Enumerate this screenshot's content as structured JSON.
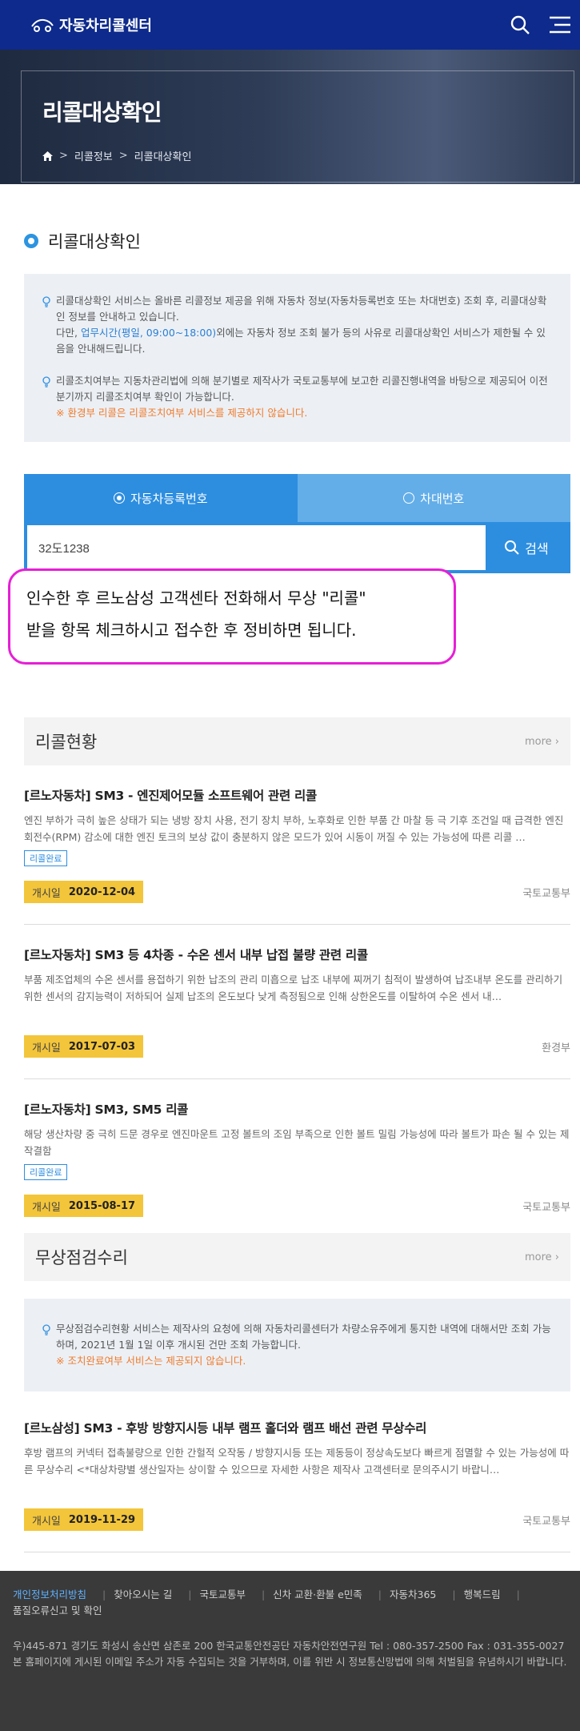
{
  "header": {
    "logo": "자동차리콜센터"
  },
  "hero": {
    "title": "리콜대상확인",
    "crumbs": [
      "리콜정보",
      "리콜대상확인"
    ]
  },
  "section": {
    "title": "리콜대상확인"
  },
  "info": {
    "p1_a": "리콜대상확인 서비스는 올바른 리콜정보 제공을 위해 자동차 정보(자동차등록번호 또는 차대번호) 조회 후, 리콜대상확인 정보를 안내하고 있습니다.",
    "p1_b_pre": "다만, ",
    "p1_b_link": "업무시간(평일, 09:00~18:00)",
    "p1_b_post": "외에는 자동차 정보 조회 불가 등의 사유로 리콜대상확인 서비스가 제한될 수 있음을 안내해드립니다.",
    "p2": "리콜조치여부는 지동차관리법에 의해 분기별로 제작사가 국토교통부에 보고한 리콜진행내역을 바탕으로 제공되어 이전 분기까지 리콜조치여부 확인이 가능합니다.",
    "p2_warn": "※ 환경부 리콜은 리콜조치여부 서비스를 제공하지 않습니다."
  },
  "tabs": [
    {
      "label": "자동차등록번호"
    },
    {
      "label": "차대번호"
    }
  ],
  "search": {
    "value": "32도1238",
    "button": "검색"
  },
  "note": {
    "line1": "인수한 후  르노삼성 고객센타 전화해서 무상 \"리콜\"",
    "line2": "받을 항목 체크하시고 접수한 후  정비하면 됩니다."
  },
  "recall": {
    "title": "리콜현황",
    "more": "more",
    "items": [
      {
        "title": "[르노자동차] SM3 - 엔진제어모듈 소프트웨어 관련 리콜",
        "desc": "엔진 부하가 극히 높은 상태가 되는 냉방 장치 사용, 전기 장치 부하, 노후화로 인한 부품 간 마찰 등 극 기후 조건일 때 급격한 엔진회전수(RPM) 감소에 대한 엔진 토크의 보상 값이 충분하지 않은 모드가 있어 시동이 꺼질 수 있는 가능성에 따른 리콜 …",
        "badge": "리콜완료",
        "date_label": "개시일",
        "date": "2020-12-04",
        "org": "국토교통부"
      },
      {
        "title": "[르노자동차] SM3 등 4차종 - 수온 센서 내부 납접 불량 관련 리콜",
        "desc": "부품 제조업체의 수온 센서를 용접하기 위한 납조의 관리 미흡으로 납조 내부에 찌꺼기 침적이 발생하여 납조내부 온도를 관리하기 위한 센서의 감지능력이 저하되어 실제 납조의 온도보다 낮게 측정됨으로 인해 상한온도를 이탈하여 수온 센서 내…",
        "badge": "",
        "date_label": "개시일",
        "date": "2017-07-03",
        "org": "환경부"
      },
      {
        "title": "[르노자동차] SM3, SM5 리콜",
        "desc": "해당 생산차량 중 극히 드문 경우로 엔진마운트 고정 볼트의 조임 부족으로 인한 볼트 밀림 가능성에 따라 볼트가 파손 될 수 있는 제작결함",
        "badge": "리콜완료",
        "date_label": "개시일",
        "date": "2015-08-17",
        "org": "국토교통부"
      }
    ]
  },
  "free": {
    "title": "무상점검수리",
    "more": "more",
    "info": "무상점검수리현황 서비스는 제작사의 요청에 의해 자동차리콜센터가 차량소유주에게 통지한 내역에 대해서만 조회 가능하며, 2021년 1월 1일 이후 개시된 건만 조회 가능합니다.",
    "warn": "※ 조치완료여부 서비스는 제공되지 않습니다.",
    "items": [
      {
        "title": "[르노삼성] SM3 - 후방 방향지시등 내부 램프 홀더와 램프 배선 관련 무상수리",
        "desc": "후방 램프의 커넥터 접촉불량으로 인한 간헐적 오작동 / 방향지시등 또는 제동등이 정상속도보다 빠르게 점멸할 수 있는 가능성에 따른 무상수리 <*대상차량별 생산일자는 상이할 수 있으므로 자세한 사항은 제작사 고객센터로 문의주시기 바랍니…",
        "date_label": "개시일",
        "date": "2019-11-29",
        "org": "국토교통부"
      }
    ]
  },
  "footer": {
    "links": [
      "개인정보처리방침",
      "찾아오시는 길",
      "국토교통부",
      "신차 교환·환불 e민족",
      "자동차365",
      "행복드림",
      "품질오류신고 및 확인"
    ],
    "addr": "우)445-871 경기도 화성시 송산면 삼존로 200 한국교통안전공단 자동차안전연구원 Tel : 080-357-2500 Fax : 031-355-0027",
    "notice": "본 홈페이지에 게시된 이메일 주소가 자동 수집되는 것을 거부하며, 이를 위반 시 정보통신망법에 의해 처벌됨을 유념하시기 바랍니다."
  }
}
